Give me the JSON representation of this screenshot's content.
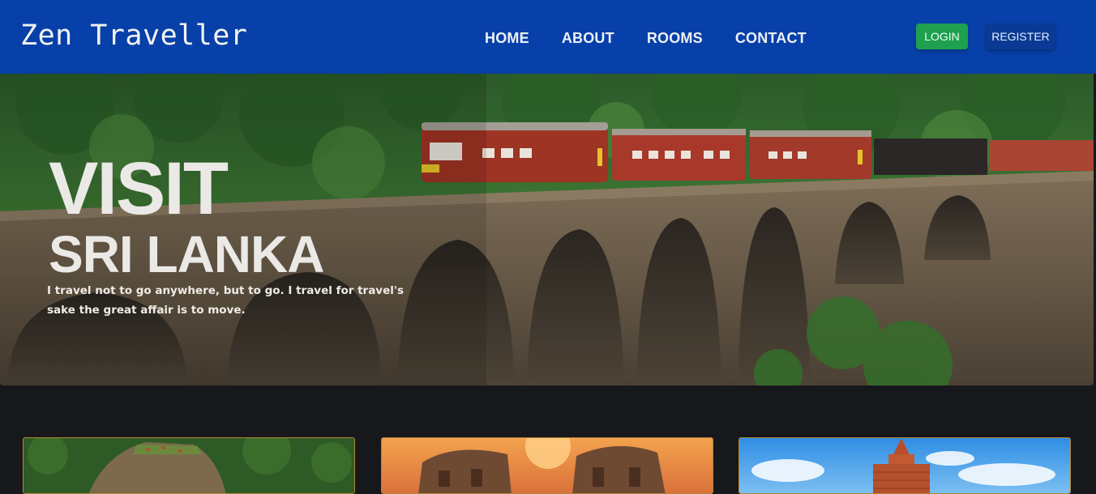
{
  "brand": "Zen Traveller",
  "nav": {
    "links": [
      "HOME",
      "ABOUT",
      "ROOMS",
      "CONTACT"
    ],
    "login_label": "LOGIN",
    "register_label": "REGISTER"
  },
  "hero": {
    "title_line1": "VISIT",
    "title_line2": "SRI LANKA",
    "quote": "I travel not to go anywhere, but to go. I travel for travel's sake the great affair is to move."
  },
  "colors": {
    "navbar": "#0740a8",
    "login": "#1ea04f",
    "register": "#0a3a95",
    "page_bg": "#17181b",
    "card_border": "#b08a37"
  },
  "cards": [
    {
      "icon": "sigiriya-image"
    },
    {
      "icon": "ruins-image"
    },
    {
      "icon": "stupa-image"
    }
  ]
}
